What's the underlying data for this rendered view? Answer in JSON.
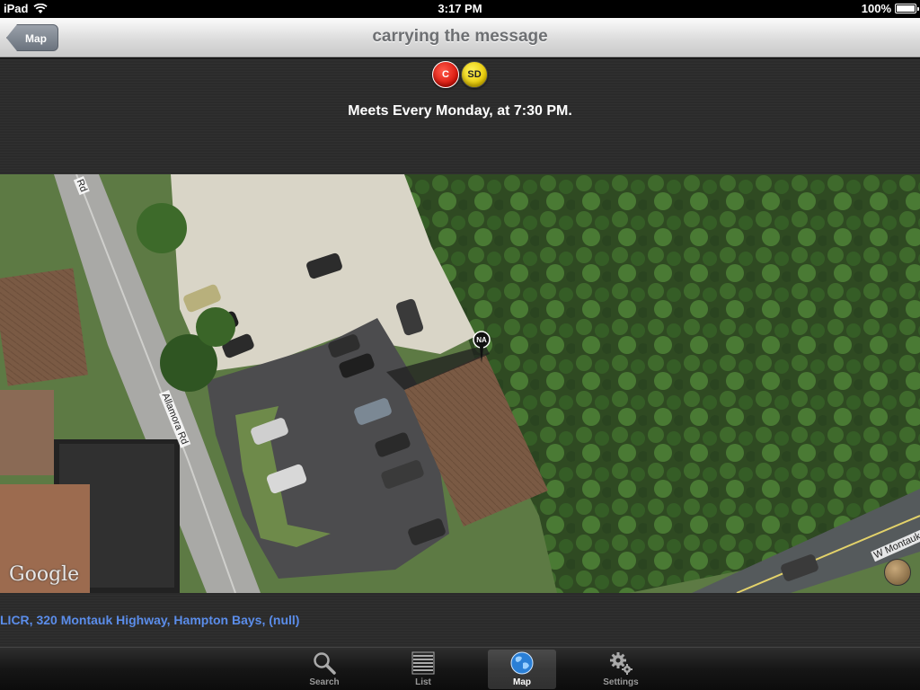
{
  "status_bar": {
    "device": "iPad",
    "time": "3:17 PM",
    "battery": "100%",
    "battery_level": 1.0
  },
  "nav_bar": {
    "back_label": "Map",
    "title": "carrying the message"
  },
  "header": {
    "badges": [
      {
        "label": "C",
        "color": "#d8140a"
      },
      {
        "label": "SD",
        "color": "#e6c600"
      }
    ],
    "meeting_text": "Meets Every Monday, at 7:30 PM."
  },
  "map": {
    "attribution": "Google",
    "road_labels": {
      "allamora": "Allamora Rd",
      "top": "Rd",
      "w_montauk": "W Montauk"
    },
    "pin_label": "NA"
  },
  "address": {
    "text": "LICR, 320 Montauk Highway, Hampton Bays, (null)"
  },
  "tab_bar": {
    "tabs": [
      {
        "label": "Search",
        "icon": "search-icon"
      },
      {
        "label": "List",
        "icon": "list-icon"
      },
      {
        "label": "Map",
        "icon": "globe-icon",
        "active": true
      },
      {
        "label": "Settings",
        "icon": "gear-icon"
      }
    ]
  }
}
